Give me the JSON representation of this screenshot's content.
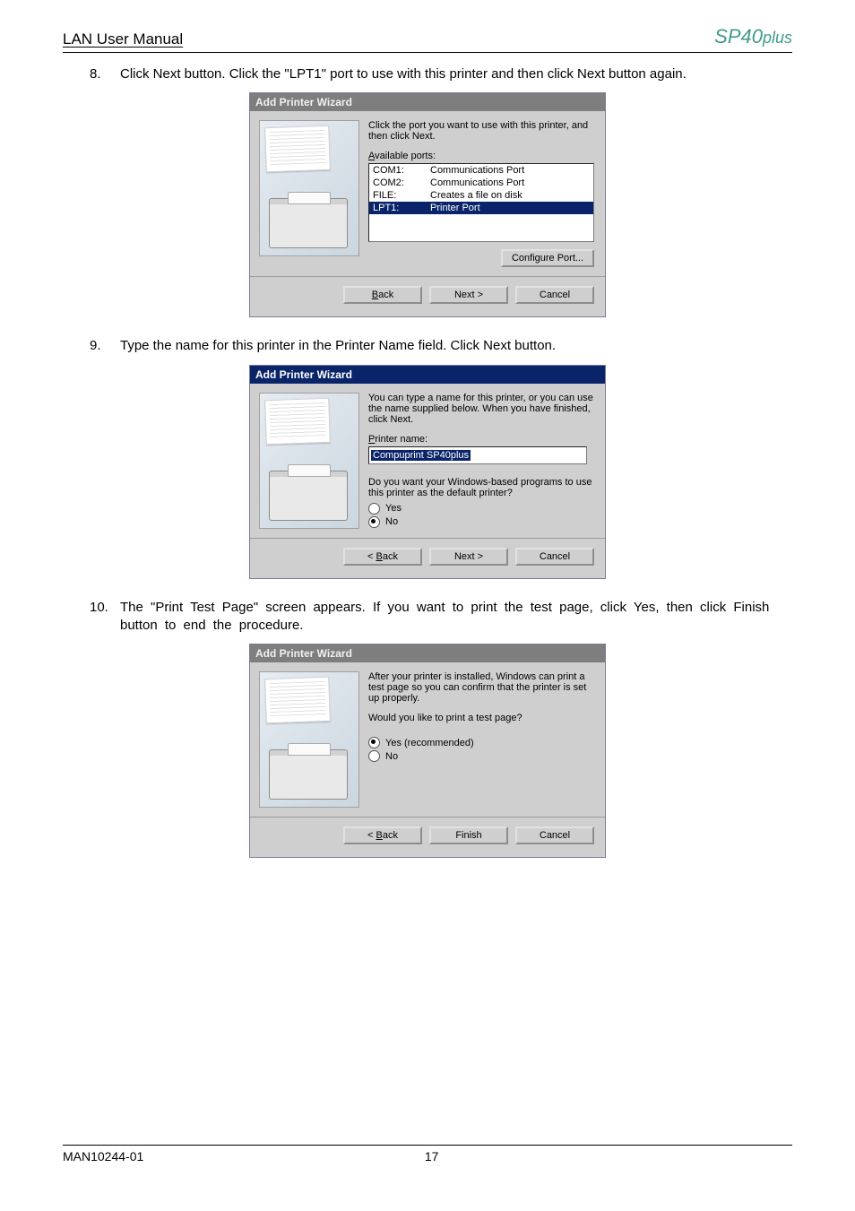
{
  "header": {
    "manual_title": "LAN User Manual",
    "product": "SP40",
    "product_suffix": "plus"
  },
  "steps": {
    "s8": {
      "num": "8.",
      "text": "Click Next button. Click the \"LPT1\" port to use with this printer and then click Next button again."
    },
    "s9": {
      "num": "9.",
      "text": "Type the name for this printer in the Printer Name field. Click Next button."
    },
    "s10": {
      "num": "10.",
      "text": "The \"Print   Test  Page\" screen appears. If you  want  to  print the  test  page,  click  Yes, then  click Finish  button to  end  the procedure."
    }
  },
  "dialog1": {
    "title": "Add Printer Wizard",
    "instruction": "Click the port you want to use with this printer, and then click Next.",
    "ports_label_pre": "A",
    "ports_label_suf": "vailable ports:",
    "rows": [
      {
        "c1": "COM1:",
        "c2": "Communications Port",
        "sel": false
      },
      {
        "c1": "COM2:",
        "c2": "Communications Port",
        "sel": false
      },
      {
        "c1": "FILE:",
        "c2": "Creates a file on disk",
        "sel": false
      },
      {
        "c1": "LPT1:",
        "c2": "Printer Port",
        "sel": true
      }
    ],
    "configure": "Configure Port...",
    "back": "< Back",
    "next": "Next >",
    "cancel": "Cancel"
  },
  "dialog2": {
    "title": "Add Printer Wizard",
    "instruction": "You can type a name for this printer, or you can use the name supplied below. When you have finished, click Next.",
    "name_label_pre": "P",
    "name_label_suf": "rinter name:",
    "printer_name": "Compuprint SP40plus",
    "default_q": "Do you want your Windows-based programs to use this printer as the default printer?",
    "yes_pre": "Y",
    "yes_suf": "es",
    "no_pre": "N",
    "no_suf": "o",
    "yes_checked": false,
    "no_checked": true,
    "back": "< Back",
    "next": "Next >",
    "cancel": "Cancel"
  },
  "dialog3": {
    "title": "Add Printer Wizard",
    "instruction": "After your printer is installed, Windows can print a test page so you can confirm that the printer is set up properly.",
    "question": "Would you like to print a test page?",
    "yes_pre": "Y",
    "yes_suf": "es (recommended)",
    "no_pre": "N",
    "no_suf": "o",
    "yes_checked": true,
    "no_checked": false,
    "back": "< Back",
    "finish": "Finish",
    "cancel": "Cancel"
  },
  "footer": {
    "doc_id": "MAN10244-01",
    "page": "17"
  }
}
